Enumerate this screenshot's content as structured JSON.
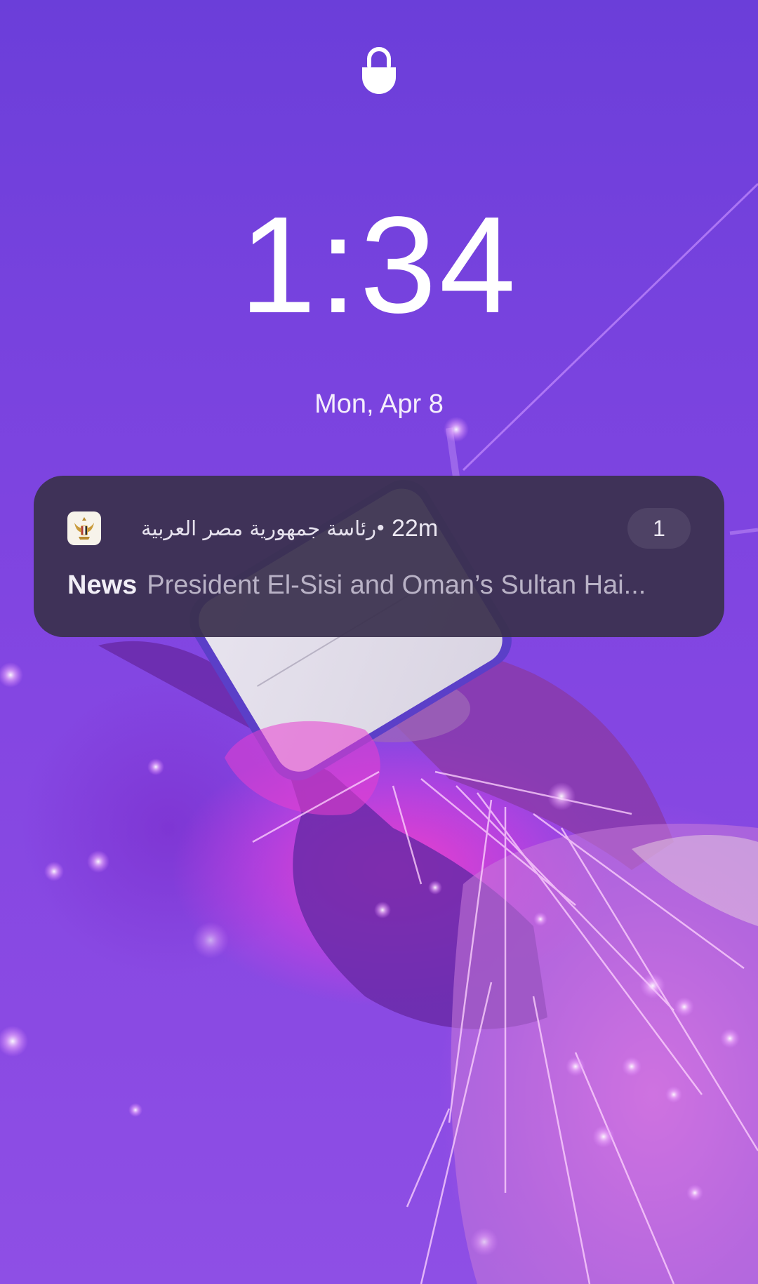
{
  "lockscreen": {
    "time": "1:34",
    "date": "Mon, Apr 8"
  },
  "notification": {
    "app_name": "رئاسة جمهورية مصر العربية",
    "separator": "•",
    "time_ago": "22m",
    "count": "1",
    "title": "News",
    "text": "President El-Sisi and Oman’s Sultan Hai..."
  },
  "icons": {
    "lock": "lock-icon",
    "app": "egypt-eagle-icon"
  },
  "colors": {
    "background": "#7a43df",
    "notification_background": "#3a304e",
    "text_primary": "#ffffff",
    "text_secondary": "#b9b2c6"
  }
}
